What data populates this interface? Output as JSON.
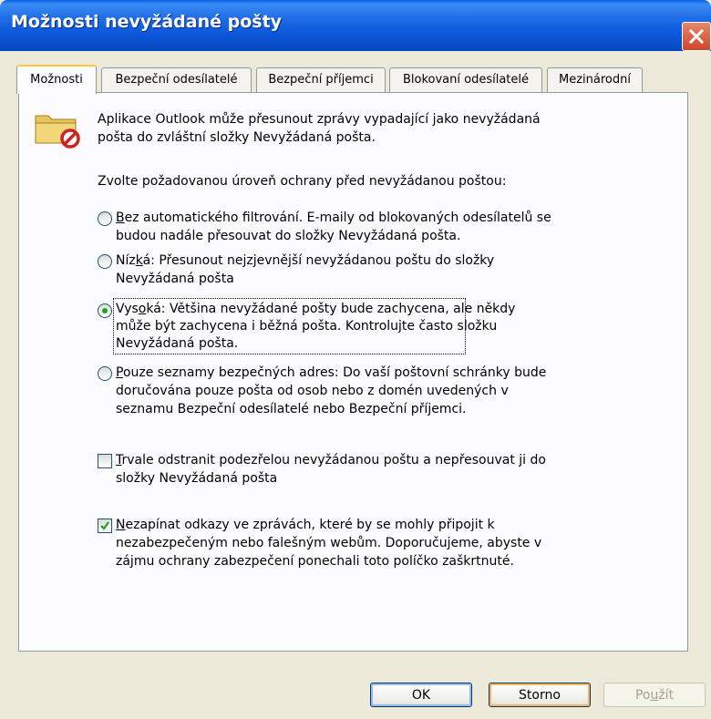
{
  "window": {
    "title": "Možnosti nevyžádané pošty"
  },
  "tabs": [
    {
      "label": "Možnosti",
      "active": true
    },
    {
      "label": "Bezpeční odesílatelé"
    },
    {
      "label": "Bezpeční příjemci"
    },
    {
      "label": "Blokovaní odesílatelé"
    },
    {
      "label": "Mezinárodní"
    }
  ],
  "intro": {
    "line1": "Aplikace Outlook může přesunout zprávy vypadající jako nevyžádaná",
    "line2": "pošta do zvláštní složky Nevyžádaná pošta."
  },
  "prompt": "Zvolte požadovanou úroveň ochrany před nevyžádanou poštou:",
  "options": [
    {
      "key": "B",
      "line1_rest": "ez automatického filtrování. E-maily od blokovaných odesílatelů se",
      "line2": "budou nadále přesouvat do složky Nevyžádaná pošta.",
      "selected": false
    },
    {
      "pre": "Níz",
      "key": "k",
      "line1_rest": "á: Přesunout nejzjevnější nevyžádanou poštu do složky",
      "line2": "Nevyžádaná pošta",
      "selected": false
    },
    {
      "pre": "Vys",
      "key": "o",
      "line1_rest": "ká: Většina nevyžádané pošty bude zachycena, ale někdy",
      "line2": "může být zachycena i běžná pošta. Kontrolujte často složku",
      "line3": "Nevyžádaná pošta.",
      "selected": true
    },
    {
      "key": "P",
      "line1_rest": "ouze seznamy bezpečných adres: Do vaší poštovní schránky bude",
      "line2": "doručována pouze pošta od osob nebo z domén uvedených v",
      "line3": "seznamu Bezpeční odesílatelé nebo Bezpeční příjemci.",
      "selected": false
    }
  ],
  "checkboxes": [
    {
      "key": "T",
      "line1_rest": "rvale odstranit podezřelou nevyžádanou poštu a nepřesouvat ji do",
      "line2": "složky Nevyžádaná pošta",
      "checked": false
    },
    {
      "key": "N",
      "line1_rest": "ezapínat odkazy ve zprávách, které by se mohly připojit k",
      "line2": "nezabezpečeným nebo falešným webům. Doporučujeme, abyste v",
      "line3": "zájmu ochrany zabezpečení ponechali toto políčko zaškrtnuté.",
      "checked": true
    }
  ],
  "buttons": {
    "ok": "OK",
    "cancel": "Storno",
    "apply_pre": "Po",
    "apply_key": "u",
    "apply_post": "žít"
  }
}
